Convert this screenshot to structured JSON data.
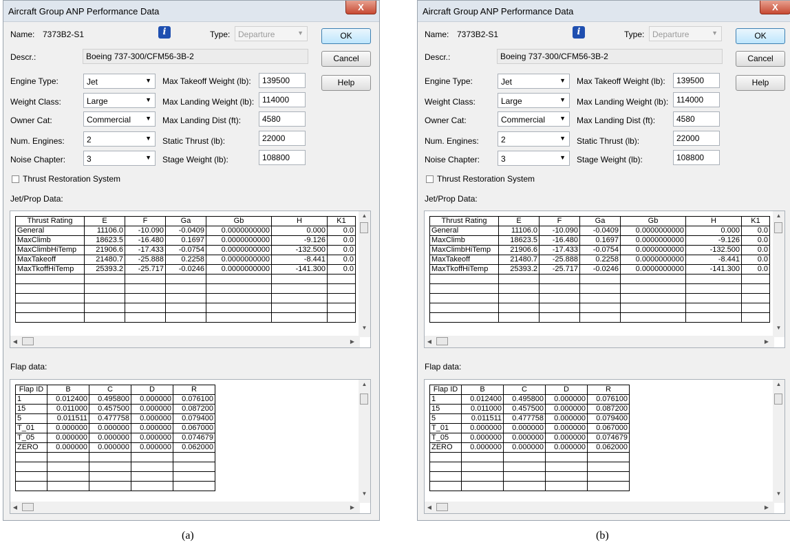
{
  "dialog": {
    "title": "Aircraft Group ANP Performance Data",
    "close_glyph": "X",
    "labels": {
      "name": "Name:",
      "type": "Type:",
      "descr": "Descr.:",
      "engine_type": "Engine Type:",
      "weight_class": "Weight Class:",
      "owner_cat": "Owner Cat:",
      "num_engines": "Num. Engines:",
      "noise_chapter": "Noise Chapter:",
      "max_takeoff_weight": "Max Takeoff Weight (lb):",
      "max_landing_weight": "Max Landing Weight (lb):",
      "max_landing_dist": "Max Landing Dist (ft):",
      "static_thrust": "Static Thrust (lb):",
      "stage_weight": "Stage Weight (lb):",
      "thrust_restoration": "Thrust Restoration System",
      "jetprop_data": "Jet/Prop Data:",
      "flap_data": "Flap data:"
    },
    "values": {
      "name": "7373B2-S1",
      "type": "Departure",
      "descr": "Boeing 737-300/CFM56-3B-2",
      "engine_type": "Jet",
      "weight_class": "Large",
      "owner_cat": "Commercial",
      "num_engines": "2",
      "noise_chapter": "3",
      "max_takeoff_weight": "139500",
      "max_landing_weight": "114000",
      "max_landing_dist": "4580",
      "static_thrust": "22000",
      "stage_weight": "108800",
      "thrust_restoration_checked": false
    },
    "buttons": {
      "ok": "OK",
      "cancel": "Cancel",
      "help": "Help"
    },
    "info_glyph": "i"
  },
  "thrust_table": {
    "columns": [
      "Thrust Rating",
      "E",
      "F",
      "Ga",
      "Gb",
      "H",
      "K1"
    ],
    "rows": [
      [
        "General",
        "11106.0",
        "-10.090",
        "-0.0409",
        "0.0000000000",
        "0.000",
        "0.0"
      ],
      [
        "MaxClimb",
        "18623.5",
        "-16.480",
        "0.1697",
        "0.0000000000",
        "-9.126",
        "0.0"
      ],
      [
        "MaxClimbHiTemp",
        "21906.6",
        "-17.433",
        "-0.0754",
        "0.0000000000",
        "-132.500",
        "0.0"
      ],
      [
        "MaxTakeoff",
        "21480.7",
        "-25.888",
        "0.2258",
        "0.0000000000",
        "-8.441",
        "0.0"
      ],
      [
        "MaxTkoffHiTemp",
        "25393.2",
        "-25.717",
        "-0.0246",
        "0.0000000000",
        "-141.300",
        "0.0"
      ]
    ]
  },
  "flap_table": {
    "columns": [
      "Flap ID",
      "B",
      "C",
      "D",
      "R"
    ],
    "rows": [
      [
        "1",
        "0.012400",
        "0.495800",
        "0.000000",
        "0.076100"
      ],
      [
        "15",
        "0.011000",
        "0.457500",
        "0.000000",
        "0.087200"
      ],
      [
        "5",
        "0.011511",
        "0.477758",
        "0.000000",
        "0.079400"
      ],
      [
        "T_01",
        "0.000000",
        "0.000000",
        "0.000000",
        "0.067000"
      ],
      [
        "T_05",
        "0.000000",
        "0.000000",
        "0.000000",
        "0.074679"
      ],
      [
        "ZERO",
        "0.000000",
        "0.000000",
        "0.000000",
        "0.062000"
      ]
    ]
  },
  "captions": {
    "a": "(a)",
    "b": "(b)"
  },
  "icons": {
    "close": "close-icon",
    "info": "info-icon",
    "dropdown": "chevron-down-icon",
    "scroll_up": "scroll-up-arrow-icon",
    "scroll_down": "scroll-down-arrow-icon",
    "scroll_left": "scroll-left-arrow-icon",
    "scroll_right": "scroll-right-arrow-icon"
  }
}
